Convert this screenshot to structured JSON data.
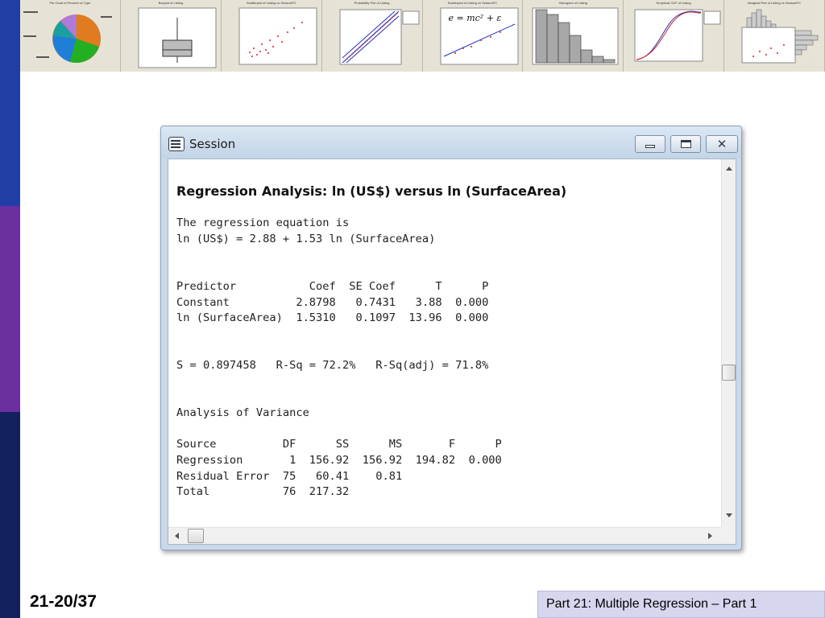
{
  "colors": {
    "bar_blue": "#1f3fa6",
    "bar_purple": "#6b2fa0",
    "bar_navy": "#13205e",
    "window_frame": "#c9d9ea",
    "footer_box": "#d6d6ee"
  },
  "thumbnails": [
    {
      "title": "Pie Chart of Percent vs Type",
      "kind": "pie"
    },
    {
      "title": "Boxplot of Listing",
      "kind": "boxplot"
    },
    {
      "title": "Scatterplot of Listing vs SeasonPC",
      "kind": "scatter"
    },
    {
      "title": "Probability Plot of Listing",
      "kind": "probability"
    },
    {
      "title": "Scatterplot of Listing vs SeasonPC",
      "kind": "equation",
      "equation": "e = mc² + ε"
    },
    {
      "title": "Histogram of Listing",
      "kind": "histogram"
    },
    {
      "title": "Empirical CDF of Listing",
      "kind": "cdf"
    },
    {
      "title": "Marginal Plot of Listing vs SeasonPC",
      "kind": "marginal"
    }
  ],
  "window": {
    "title": "Session",
    "minimize_icon": "minimize-icon",
    "maximize_icon": "maximize-icon",
    "close_icon": "close-icon"
  },
  "session": {
    "heading": "Regression Analysis: ln (US$) versus ln (SurfaceArea)",
    "equation_intro": "The regression equation is",
    "equation": "ln (US$) = 2.88 + 1.53 ln (SurfaceArea)",
    "coef_table": {
      "header": "Predictor           Coef  SE Coef      T      P",
      "rows": [
        "Constant          2.8798   0.7431   3.88  0.000",
        "ln (SurfaceArea)  1.5310   0.1097  13.96  0.000"
      ]
    },
    "fit_summary": "S = 0.897458   R-Sq = 72.2%   R-Sq(adj) = 71.8%",
    "anova_title": "Analysis of Variance",
    "anova_table": {
      "header": "Source          DF      SS      MS       F      P",
      "rows": [
        "Regression       1  156.92  156.92  194.82  0.000",
        "Residual Error  75   60.41    0.81",
        "Total           76  217.32"
      ]
    }
  },
  "footer": {
    "slide_number": "21-20/37",
    "part_label": "Part 21: Multiple Regression – Part 1"
  }
}
